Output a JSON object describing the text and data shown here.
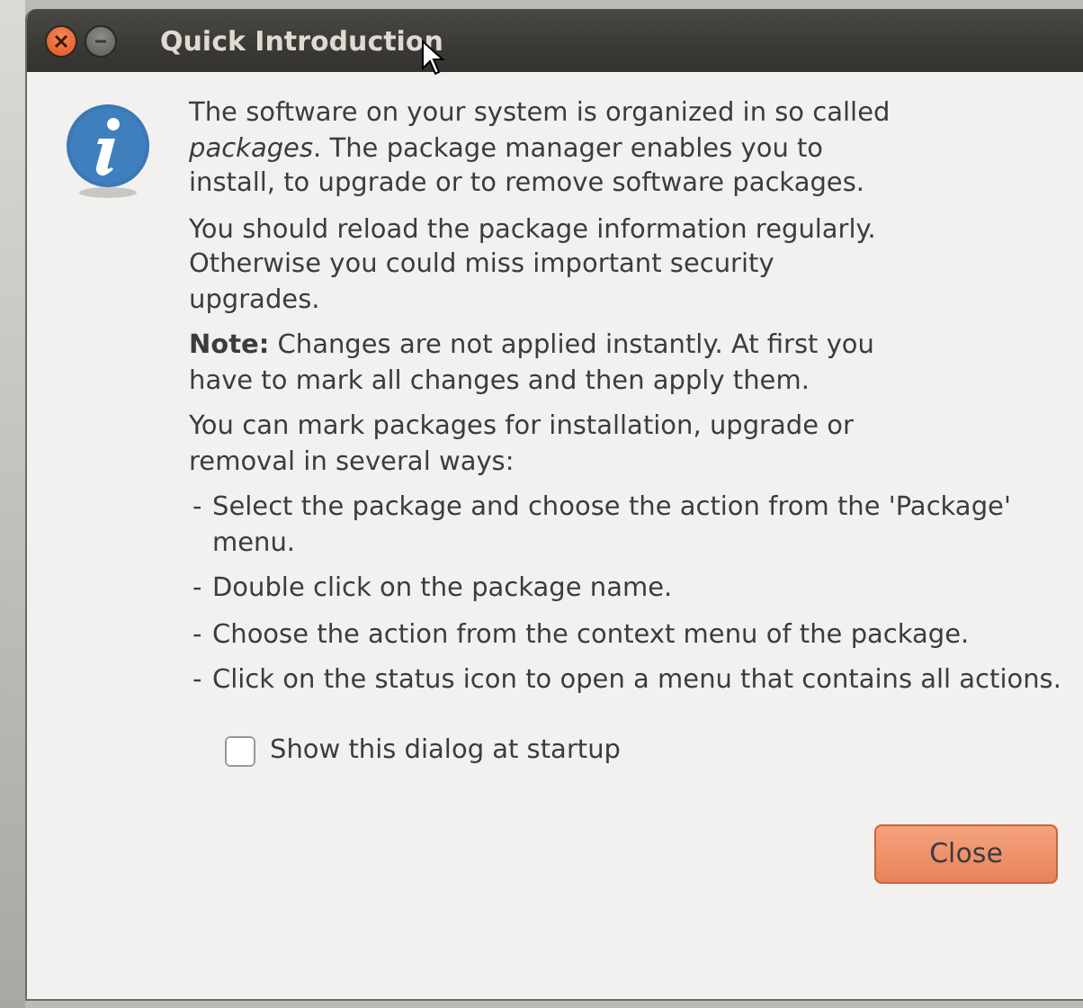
{
  "window": {
    "title": "Quick Introduction",
    "controls": [
      {
        "kind": "close"
      },
      {
        "kind": "minimize"
      }
    ]
  },
  "paragraphs": [
    "The software on your system is organized in so called *packages*. The package manager enables you to install, to upgrade or to remove software packages.",
    "You should reload the package information regularly. Otherwise you could miss important security upgrades.",
    "**Note:** Changes are not applied instantly. At first you have to mark all changes and then apply them.",
    "You can mark packages for installation, upgrade or removal in several ways:"
  ],
  "list": [
    {
      "marker": "-",
      "text": "Select the package and choose the action from the 'Package' menu."
    },
    {
      "marker": "-",
      "text": "Double click on the package name."
    },
    {
      "marker": "-",
      "text": "Choose the action from the context menu of the package."
    },
    {
      "marker": "-",
      "text": "Click on the status icon to open a menu that contains all actions."
    }
  ],
  "checkbox": {
    "label": "Show this dialog at startup",
    "checked": false
  },
  "buttons": [
    "Close"
  ]
}
